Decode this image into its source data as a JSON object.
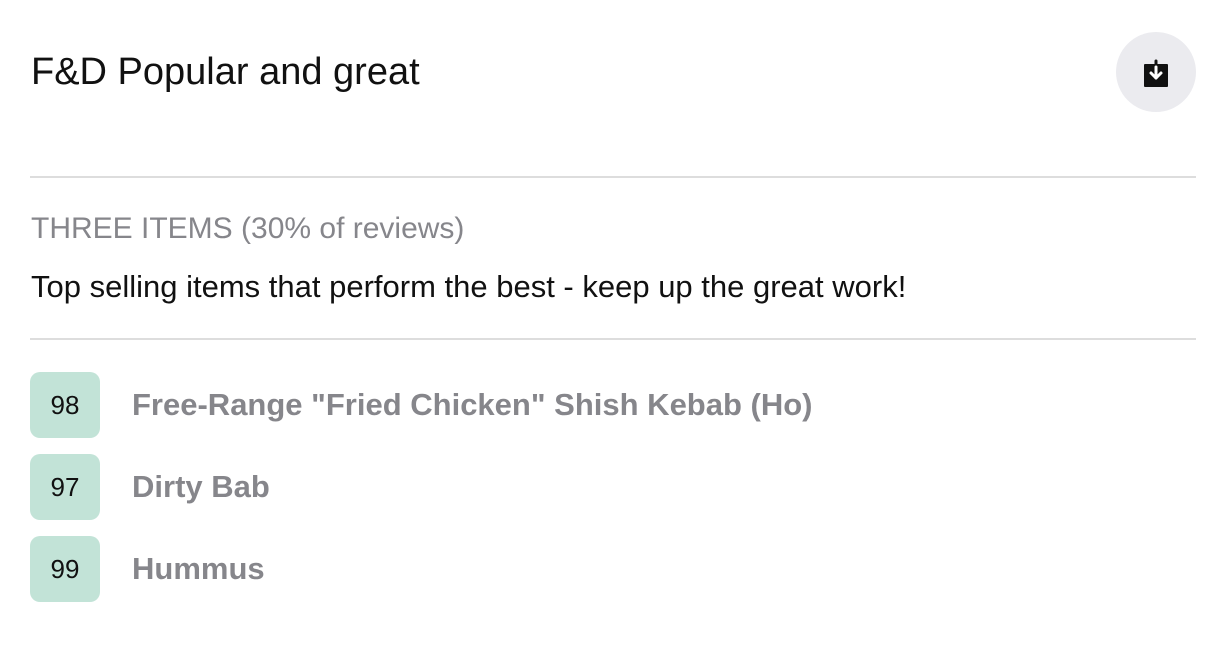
{
  "card": {
    "title": "F&D Popular and great",
    "download_icon": "download-icon"
  },
  "section": {
    "label": "THREE ITEMS (30% of reviews)",
    "description": "Top selling items that perform the best - keep up the great work!"
  },
  "items": [
    {
      "score": "98",
      "name": "Free-Range \"Fried Chicken\" Shish Kebab (Ho)"
    },
    {
      "score": "97",
      "name": "Dirty Bab"
    },
    {
      "score": "99",
      "name": "Hummus"
    }
  ],
  "colors": {
    "score_badge": "#c2e3d7",
    "muted_text": "#86868b",
    "button_bg": "#ebebef"
  }
}
